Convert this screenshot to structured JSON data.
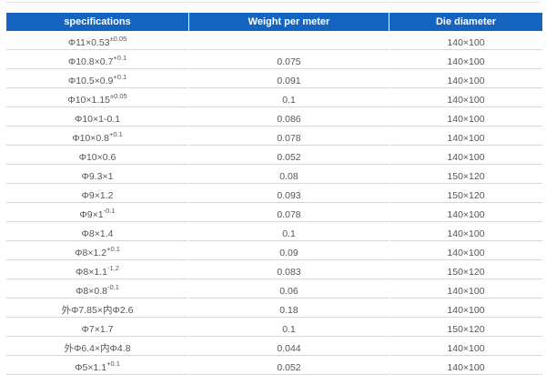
{
  "table": {
    "headers": [
      "specifications",
      "Weight per meter",
      "Die diameter"
    ],
    "rows": [
      {
        "spec": "Φ11×0.53",
        "tol": "±0.05",
        "weight": "",
        "die": "140×100"
      },
      {
        "spec": "Φ10.8×0.7",
        "tol": "+0.1",
        "weight": "0.075",
        "die": "140×100"
      },
      {
        "spec": "Φ10.5×0.9",
        "tol": "+0.1",
        "weight": "0.091",
        "die": "140×100"
      },
      {
        "spec": "Φ10×1.15",
        "tol": "±0.05",
        "weight": "0.1",
        "die": "140×100"
      },
      {
        "spec": "Φ10×1-0.1",
        "tol": "",
        "weight": "0.086",
        "die": "140×100"
      },
      {
        "spec": "Φ10×0.8",
        "tol": "+0.1",
        "weight": "0.078",
        "die": "140×100"
      },
      {
        "spec": "Φ10×0.6",
        "tol": "",
        "weight": "0.052",
        "die": "140×100"
      },
      {
        "spec": "Φ9.3×1",
        "tol": "",
        "weight": "0.08",
        "die": "150×120"
      },
      {
        "spec": "Φ9×1.2",
        "tol": "",
        "weight": "0.093",
        "die": "150×120"
      },
      {
        "spec": "Φ9×1",
        "tol": "-0.1",
        "weight": "0.078",
        "die": "140×100"
      },
      {
        "spec": "Φ8×1.4",
        "tol": "",
        "weight": "0.1",
        "die": "140×100"
      },
      {
        "spec": "Φ8×1.2",
        "tol": "+0.1",
        "weight": "0.09",
        "die": "140×100"
      },
      {
        "spec": "Φ8×1.1",
        "tol": "-1.2",
        "weight": "0.083",
        "die": "150×120"
      },
      {
        "spec": "Φ8×0.8",
        "tol": "-0.1",
        "weight": "0.06",
        "die": "140×100"
      },
      {
        "spec": "外Φ7.85×内Φ2.6",
        "tol": "",
        "weight": "0.18",
        "die": "140×100"
      },
      {
        "spec": "Φ7×1.7",
        "tol": "",
        "weight": "0.1",
        "die": "150×120"
      },
      {
        "spec": "外Φ6.4×内Φ4.8",
        "tol": "",
        "weight": "0.044",
        "die": "140×100"
      },
      {
        "spec": "Φ5×1.1",
        "tol": "+0.1",
        "weight": "0.052",
        "die": "140×100"
      }
    ]
  },
  "colors": {
    "header_bg": "#1565c0",
    "header_text": "#ffffff",
    "body_text": "#555555",
    "row_border": "#d7d7d7"
  }
}
